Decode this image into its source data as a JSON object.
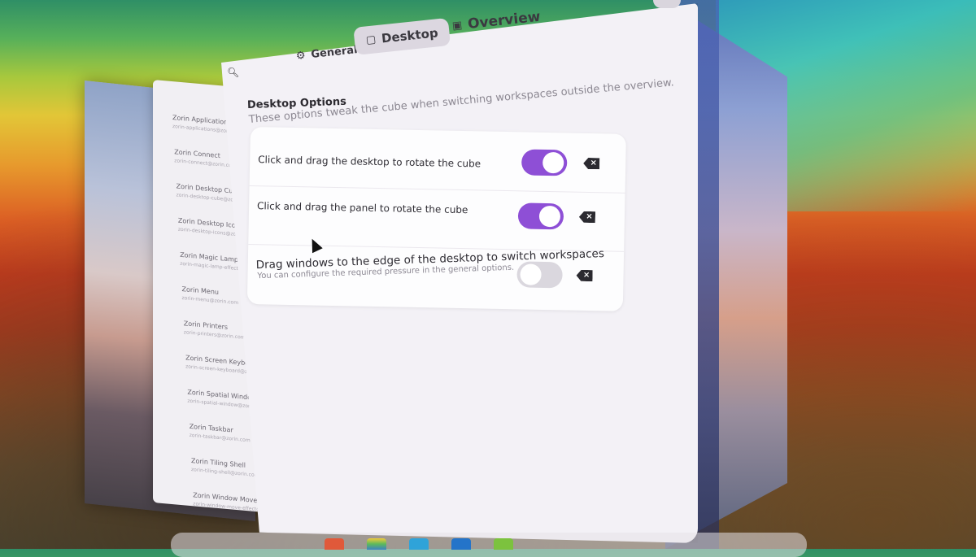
{
  "tabs": [
    {
      "label": "General",
      "icon": "gear-icon"
    },
    {
      "label": "Desktop",
      "icon": "monitor-icon",
      "active": true
    },
    {
      "label": "Overview",
      "icon": "overview-icon"
    }
  ],
  "section": {
    "title": "Desktop Options",
    "subtitle": "These options tweak the cube when switching workspaces outside the overview."
  },
  "options": [
    {
      "label": "Click and drag the desktop to rotate the cube",
      "enabled": true
    },
    {
      "label": "Click and drag the panel to rotate the cube",
      "enabled": true
    },
    {
      "label": "Drag windows to the edge of the desktop to switch workspaces",
      "description": "You can configure the required pressure in the general options.",
      "enabled": false
    }
  ],
  "background_window": {
    "items": [
      {
        "title": "Zorin Applications",
        "subtitle": "zorin-applications@zorin.com"
      },
      {
        "title": "Zorin Connect",
        "subtitle": "zorin-connect@zorin.com"
      },
      {
        "title": "Zorin Desktop Cube",
        "subtitle": "zorin-desktop-cube@zorin.com"
      },
      {
        "title": "Zorin Desktop Icons",
        "subtitle": "zorin-desktop-icons@zorin.com"
      },
      {
        "title": "Zorin Magic Lamp Effect",
        "subtitle": "zorin-magic-lamp-effect@zorin.com"
      },
      {
        "title": "Zorin Menu",
        "subtitle": "zorin-menu@zorin.com"
      },
      {
        "title": "Zorin Printers",
        "subtitle": "zorin-printers@zorin.com"
      },
      {
        "title": "Zorin Screen Keyboard",
        "subtitle": "zorin-screen-keyboard@zorin.com"
      },
      {
        "title": "Zorin Spatial Window",
        "subtitle": "zorin-spatial-window@zorin.com"
      },
      {
        "title": "Zorin Taskbar",
        "subtitle": "zorin-taskbar@zorin.com"
      },
      {
        "title": "Zorin Tiling Shell",
        "subtitle": "zorin-tiling-shell@zorin.com"
      },
      {
        "title": "Zorin Window Move Effect",
        "subtitle": "zorin-window-move-effect@zorin.com"
      }
    ]
  },
  "colors": {
    "accent": "#8e4fd6",
    "switch_off": "#dad7de",
    "window_bg": "#f3f1f6",
    "card_bg": "#fdfdfe"
  },
  "dock": {
    "icons": [
      "browser-icon",
      "files-icon",
      "store-icon",
      "software-icon",
      "extensions-icon"
    ]
  }
}
